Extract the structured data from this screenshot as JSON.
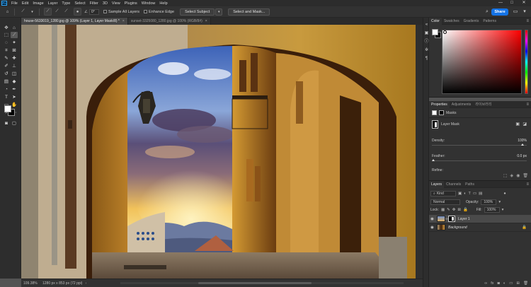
{
  "menubar": {
    "logo": "Ps",
    "items": [
      "File",
      "Edit",
      "Image",
      "Layer",
      "Type",
      "Select",
      "Filter",
      "3D",
      "View",
      "Plugins",
      "Window",
      "Help"
    ],
    "minimize": "—",
    "maximize": "□",
    "close": "✕"
  },
  "options": {
    "angle_label": "∠",
    "angle_value": "0°",
    "sample_all_layers": "Sample All Layers",
    "enhance_edge": "Enhance Edge",
    "select_subject": "Select Subject",
    "select_and_mask": "Select and Mask...",
    "share": "Share"
  },
  "tabs": [
    {
      "label": "house-5633019_1280.jpg @ 109% (Layer 1, Layer Mask/8) *",
      "active": true,
      "close": "×"
    },
    {
      "label": "sunset-3325080_1280.jpg @ 100% (RGB/8#)",
      "active": false,
      "close": "×"
    }
  ],
  "status": {
    "zoom": "109.38%",
    "doc_size": "1280 px x 853 px (72 ppi)",
    "arrow": "›"
  },
  "color_panel": {
    "tabs": [
      "Color",
      "Swatches",
      "Gradients",
      "Patterns"
    ],
    "menu": "≡",
    "foreground": "#ffffff",
    "background": "#000000",
    "hue_color": "#ff0000"
  },
  "properties_panel": {
    "tabs": [
      "Properties",
      "Adjustments",
      "라이브러리"
    ],
    "menu": "≡",
    "masks_label": "Masks",
    "layer_mask_label": "Layer Mask",
    "density_label": "Density:",
    "density_value": "100%",
    "feather_label": "Feather:",
    "feather_value": "0.0 px",
    "refine_label": "Refine:"
  },
  "layers_panel": {
    "tabs": [
      "Layers",
      "Channels",
      "Paths"
    ],
    "menu": "≡",
    "kind_label": "Kind",
    "blend_mode": "Normal",
    "opacity_label": "Opacity:",
    "opacity_value": "100%",
    "lock_label": "Lock:",
    "fill_label": "Fill:",
    "fill_value": "100%",
    "layers": [
      {
        "name": "Layer 1",
        "selected": true
      },
      {
        "name": "Background",
        "selected": false
      }
    ],
    "bottom_icons": [
      "link-icon",
      "fx-icon",
      "mask-icon",
      "adjustment-icon",
      "group-icon",
      "new-layer-icon",
      "trash-icon"
    ]
  },
  "toolbar": {
    "tools": [
      "move-tool",
      "marquee-tool",
      "lasso-tool",
      "quick-select-tool",
      "crop-tool",
      "frame-tool",
      "eyedropper-tool",
      "healing-tool",
      "brush-tool",
      "clone-stamp-tool",
      "history-brush-tool",
      "eraser-tool",
      "gradient-tool",
      "blur-tool",
      "dodge-tool",
      "pen-tool",
      "type-tool",
      "path-select-tool",
      "rectangle-tool",
      "hand-tool",
      "zoom-tool",
      "more-tools"
    ]
  }
}
